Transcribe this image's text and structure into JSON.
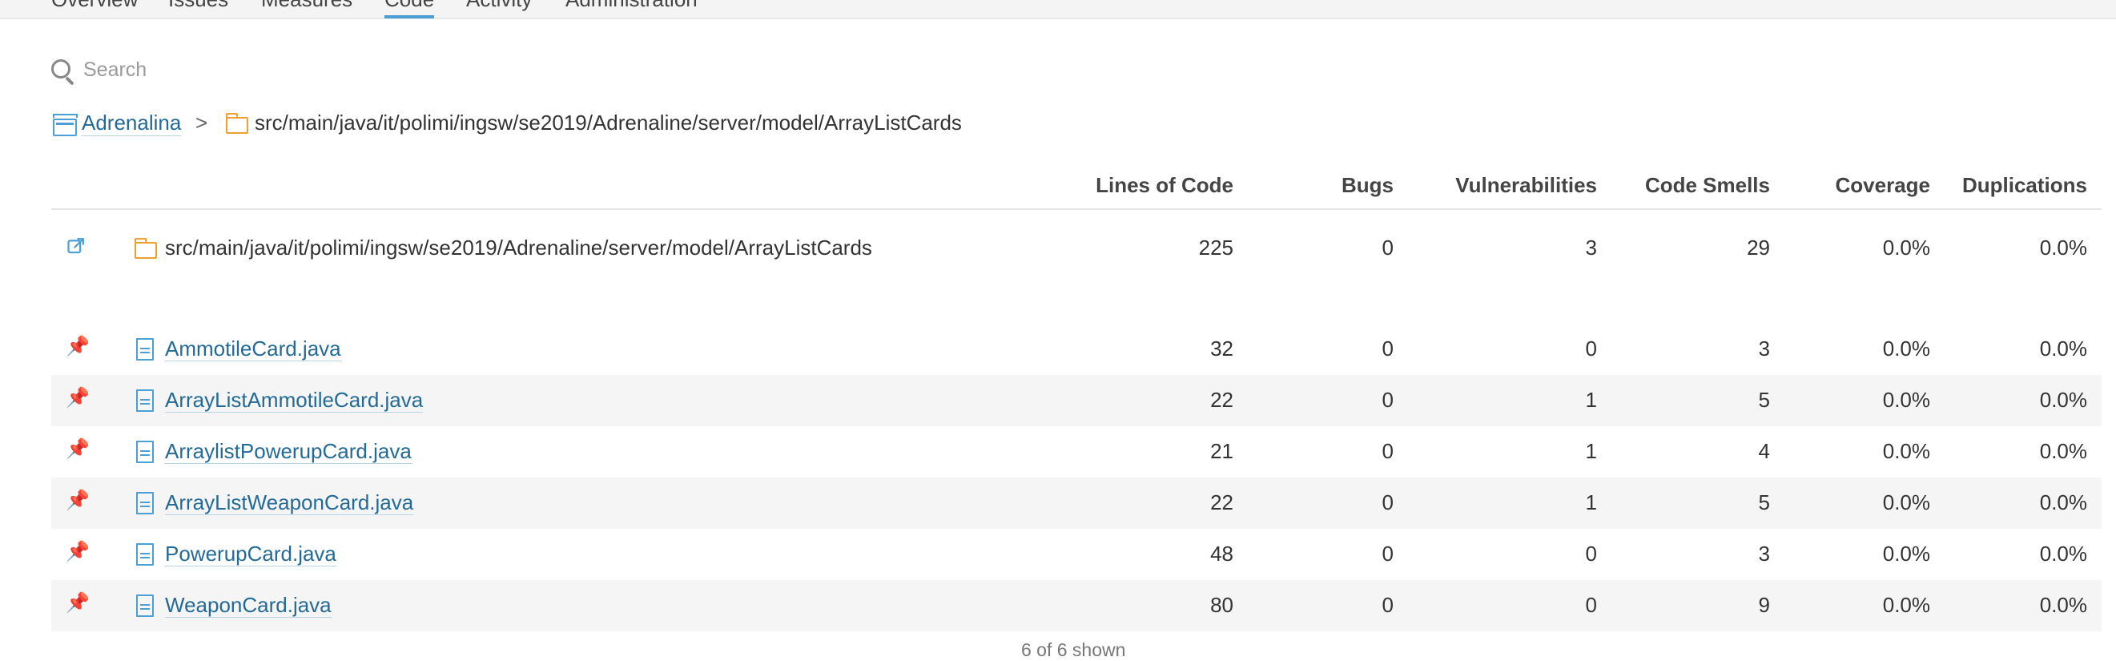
{
  "nav": {
    "tabs": [
      "Overview",
      "Issues",
      "Measures",
      "Code",
      "Activity",
      "Administration"
    ],
    "active": "Code"
  },
  "search": {
    "placeholder": "Search",
    "value": ""
  },
  "breadcrumb": {
    "project": "Adrenalina",
    "separator": ">",
    "path": "src/main/java/it/polimi/ingsw/se2019/Adrenaline/server/model/ArrayListCards"
  },
  "columns": {
    "loc": "Lines of Code",
    "bugs": "Bugs",
    "vulnerabilities": "Vulnerabilities",
    "code_smells": "Code Smells",
    "coverage": "Coverage",
    "duplications": "Duplications"
  },
  "base_row": {
    "name": "src/main/java/it/polimi/ingsw/se2019/Adrenaline/server/model/ArrayListCards",
    "loc": "225",
    "bugs": "0",
    "vulnerabilities": "3",
    "code_smells": "29",
    "coverage": "0.0%",
    "duplications": "0.0%"
  },
  "files": [
    {
      "name": "AmmotileCard.java",
      "loc": "32",
      "bugs": "0",
      "vulnerabilities": "0",
      "code_smells": "3",
      "coverage": "0.0%",
      "duplications": "0.0%"
    },
    {
      "name": "ArrayListAmmotileCard.java",
      "loc": "22",
      "bugs": "0",
      "vulnerabilities": "1",
      "code_smells": "5",
      "coverage": "0.0%",
      "duplications": "0.0%"
    },
    {
      "name": "ArraylistPowerupCard.java",
      "loc": "21",
      "bugs": "0",
      "vulnerabilities": "1",
      "code_smells": "4",
      "coverage": "0.0%",
      "duplications": "0.0%"
    },
    {
      "name": "ArrayListWeaponCard.java",
      "loc": "22",
      "bugs": "0",
      "vulnerabilities": "1",
      "code_smells": "5",
      "coverage": "0.0%",
      "duplications": "0.0%"
    },
    {
      "name": "PowerupCard.java",
      "loc": "48",
      "bugs": "0",
      "vulnerabilities": "0",
      "code_smells": "3",
      "coverage": "0.0%",
      "duplications": "0.0%"
    },
    {
      "name": "WeaponCard.java",
      "loc": "80",
      "bugs": "0",
      "vulnerabilities": "0",
      "code_smells": "9",
      "coverage": "0.0%",
      "duplications": "0.0%"
    }
  ],
  "footer": "6 of 6 shown",
  "icons": {
    "search": "search-icon",
    "project": "project-icon",
    "folder": "folder-icon",
    "file": "file-icon",
    "pin": "pin-icon",
    "open": "external-link-icon"
  },
  "colors": {
    "link": "#236a97",
    "accent": "#4b9fd5",
    "folder": "#f0a030",
    "row_alt": "#f5f5f5"
  }
}
